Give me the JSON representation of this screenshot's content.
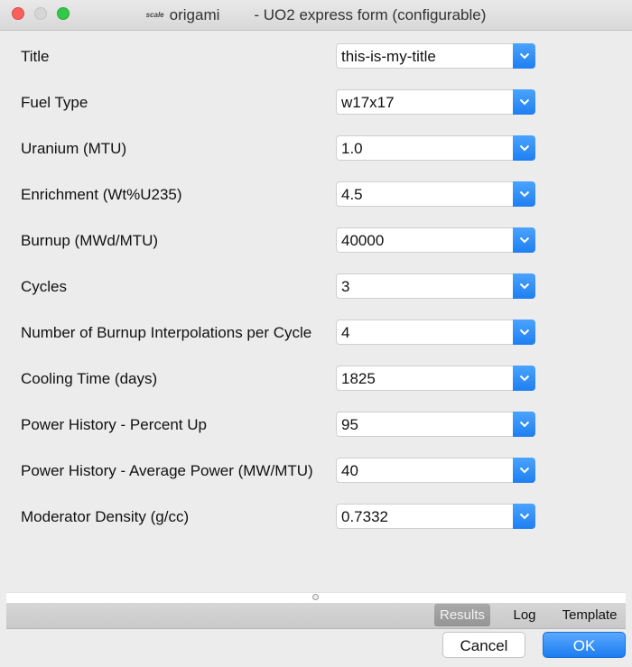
{
  "window": {
    "app_logo": "scale",
    "app_name": "origami",
    "form_title": "- UO2 express form (configurable)"
  },
  "form": {
    "fields": [
      {
        "label": "Title",
        "value": "this-is-my-title"
      },
      {
        "label": "Fuel Type",
        "value": "w17x17"
      },
      {
        "label": "Uranium (MTU)",
        "value": "1.0"
      },
      {
        "label": "Enrichment (Wt%U235)",
        "value": "4.5"
      },
      {
        "label": "Burnup (MWd/MTU)",
        "value": "40000"
      },
      {
        "label": "Cycles",
        "value": "3"
      },
      {
        "label": "Number of Burnup Interpolations per Cycle",
        "value": "4"
      },
      {
        "label": "Cooling Time (days)",
        "value": "1825"
      },
      {
        "label": "Power History - Percent Up",
        "value": "95"
      },
      {
        "label": "Power History - Average Power (MW/MTU)",
        "value": "40"
      },
      {
        "label": "Moderator Density (g/cc)",
        "value": "0.7332"
      }
    ]
  },
  "tabs": {
    "results": "Results",
    "log": "Log",
    "template": "Template"
  },
  "buttons": {
    "cancel": "Cancel",
    "ok": "OK"
  },
  "colors": {
    "accent": "#1f7ff0",
    "close": "#fc605c",
    "maximize": "#34c84a"
  }
}
